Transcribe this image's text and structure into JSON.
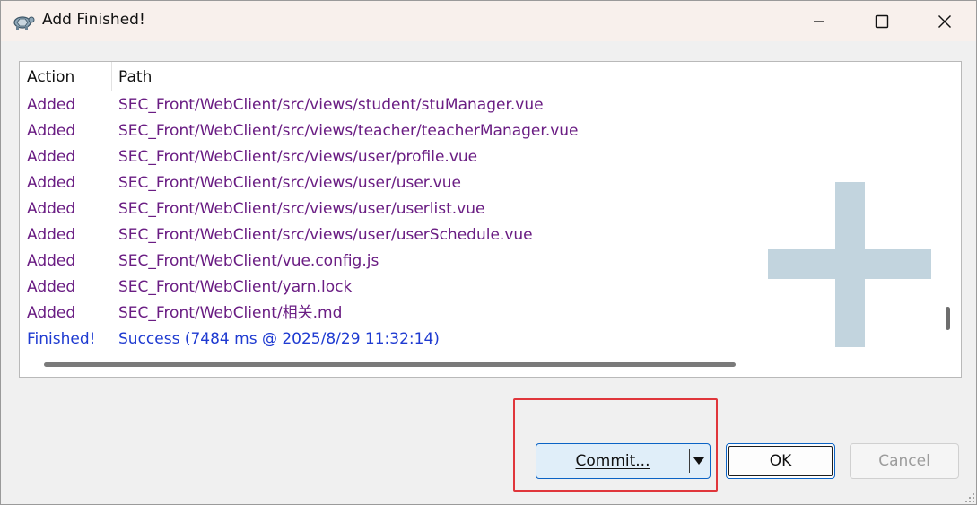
{
  "window": {
    "title": "Add Finished!"
  },
  "table": {
    "headers": {
      "action": "Action",
      "path": "Path"
    },
    "rows": [
      {
        "action": "Added",
        "path": "SEC_Front/WebClient/src/views/student/stuManager.vue"
      },
      {
        "action": "Added",
        "path": "SEC_Front/WebClient/src/views/teacher/teacherManager.vue"
      },
      {
        "action": "Added",
        "path": "SEC_Front/WebClient/src/views/user/profile.vue"
      },
      {
        "action": "Added",
        "path": "SEC_Front/WebClient/src/views/user/user.vue"
      },
      {
        "action": "Added",
        "path": "SEC_Front/WebClient/src/views/user/userlist.vue"
      },
      {
        "action": "Added",
        "path": "SEC_Front/WebClient/src/views/user/userSchedule.vue"
      },
      {
        "action": "Added",
        "path": "SEC_Front/WebClient/vue.config.js"
      },
      {
        "action": "Added",
        "path": "SEC_Front/WebClient/yarn.lock"
      },
      {
        "action": "Added",
        "path": "SEC_Front/WebClient/相关.md"
      },
      {
        "action": "Finished!",
        "path": "Success (7484 ms @ 2025/8/29 11:32:14)"
      }
    ]
  },
  "buttons": {
    "commit": "Commit...",
    "ok": "OK",
    "cancel": "Cancel"
  },
  "colors": {
    "added": "#6a1d83",
    "finished": "#1f3bd1",
    "highlight": "#e0363b",
    "accent": "#0b63c5"
  }
}
